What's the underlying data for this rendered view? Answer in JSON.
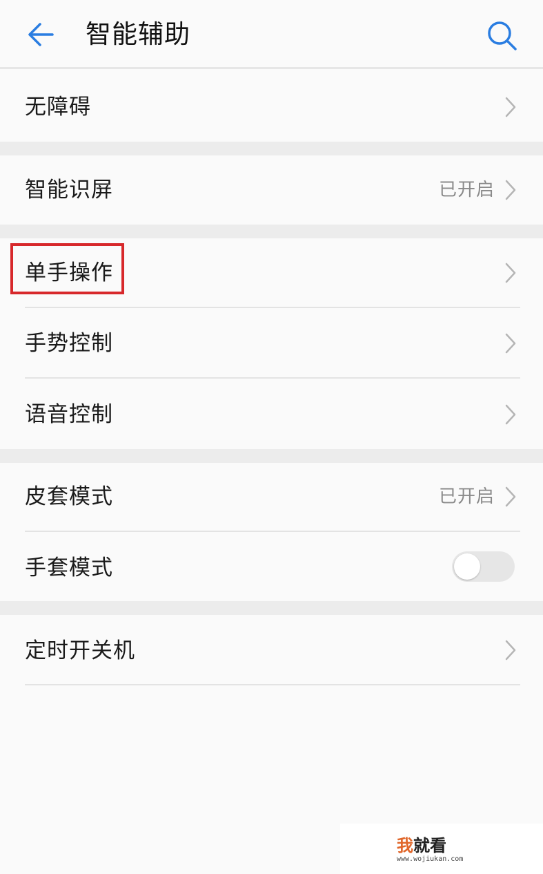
{
  "header": {
    "title": "智能辅助",
    "back_icon": "arrow-left-icon",
    "search_icon": "search-icon",
    "accent_color": "#2a7de1"
  },
  "items": [
    {
      "label": "无障碍",
      "value": "",
      "control": "chevron"
    },
    {
      "label": "智能识屏",
      "value": "已开启",
      "control": "chevron"
    },
    {
      "label": "单手操作",
      "value": "",
      "control": "chevron",
      "highlighted": true
    },
    {
      "label": "手势控制",
      "value": "",
      "control": "chevron"
    },
    {
      "label": "语音控制",
      "value": "",
      "control": "chevron"
    },
    {
      "label": "皮套模式",
      "value": "已开启",
      "control": "chevron"
    },
    {
      "label": "手套模式",
      "value": "",
      "control": "toggle",
      "toggle_on": false
    },
    {
      "label": "定时开关机",
      "value": "",
      "control": "chevron"
    }
  ],
  "highlight_color": "#d7282b",
  "watermark": {
    "logo_part1": "我",
    "logo_part2": "就看",
    "url": "www.wojiukan.com"
  }
}
